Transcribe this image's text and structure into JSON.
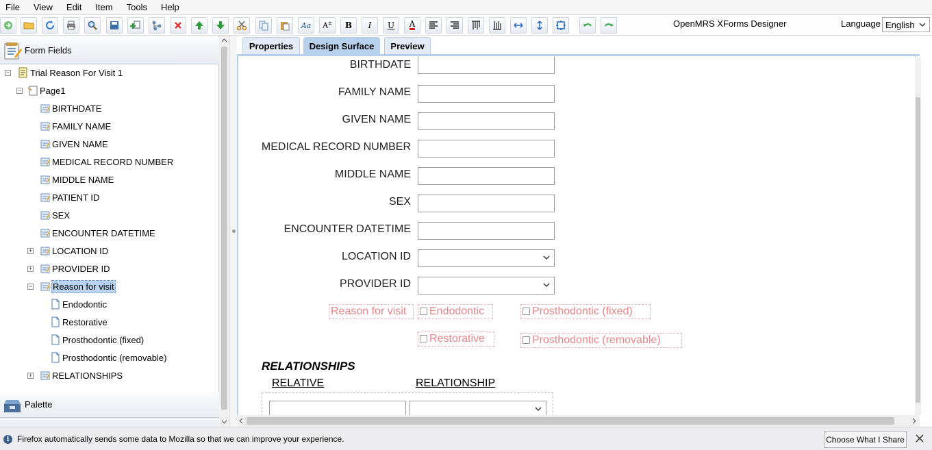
{
  "menu": [
    "File",
    "View",
    "Edit",
    "Item",
    "Tools",
    "Help"
  ],
  "app_title": "OpenMRS XForms Designer",
  "language": {
    "label": "Language",
    "value": "English"
  },
  "left_panel": {
    "header": "Form Fields",
    "tree": {
      "form": "Trial Reason For Visit 1",
      "page": "Page1",
      "fields": [
        "BIRTHDATE",
        "FAMILY NAME",
        "GIVEN NAME",
        "MEDICAL RECORD NUMBER",
        "MIDDLE NAME",
        "PATIENT ID",
        "SEX",
        "ENCOUNTER DATETIME"
      ],
      "location": "LOCATION ID",
      "provider": "PROVIDER ID",
      "reason": "Reason for visit",
      "reason_options": [
        "Endodontic",
        "Restorative",
        "Prosthodontic (fixed)",
        "Prosthodontic (removable)"
      ],
      "relationships": "RELATIONSHIPS"
    },
    "palette": "Palette"
  },
  "tabs": [
    "Properties",
    "Design Surface",
    "Preview"
  ],
  "active_tab": "Design Surface",
  "surface": {
    "fields": [
      {
        "label": "BIRTHDATE",
        "type": "text"
      },
      {
        "label": "FAMILY NAME",
        "type": "text"
      },
      {
        "label": "GIVEN NAME",
        "type": "text"
      },
      {
        "label": "MEDICAL RECORD NUMBER",
        "type": "text"
      },
      {
        "label": "MIDDLE NAME",
        "type": "text"
      },
      {
        "label": "SEX",
        "type": "text"
      },
      {
        "label": "ENCOUNTER DATETIME",
        "type": "text"
      },
      {
        "label": "LOCATION ID",
        "type": "select"
      },
      {
        "label": "PROVIDER ID",
        "type": "select"
      }
    ],
    "reason_label": "Reason for visit",
    "reason_options": [
      "Endodontic",
      "Prosthodontic (fixed)",
      "Restorative",
      "Prosthodontic (removable)"
    ],
    "relationships": {
      "title": "RELATIONSHIPS",
      "col_relative": "RELATIVE",
      "col_relationship": "RELATIONSHIP"
    }
  },
  "notification": {
    "message": "Firefox automatically sends some data to Mozilla so that we can improve your experience.",
    "button": "Choose What I Share"
  }
}
